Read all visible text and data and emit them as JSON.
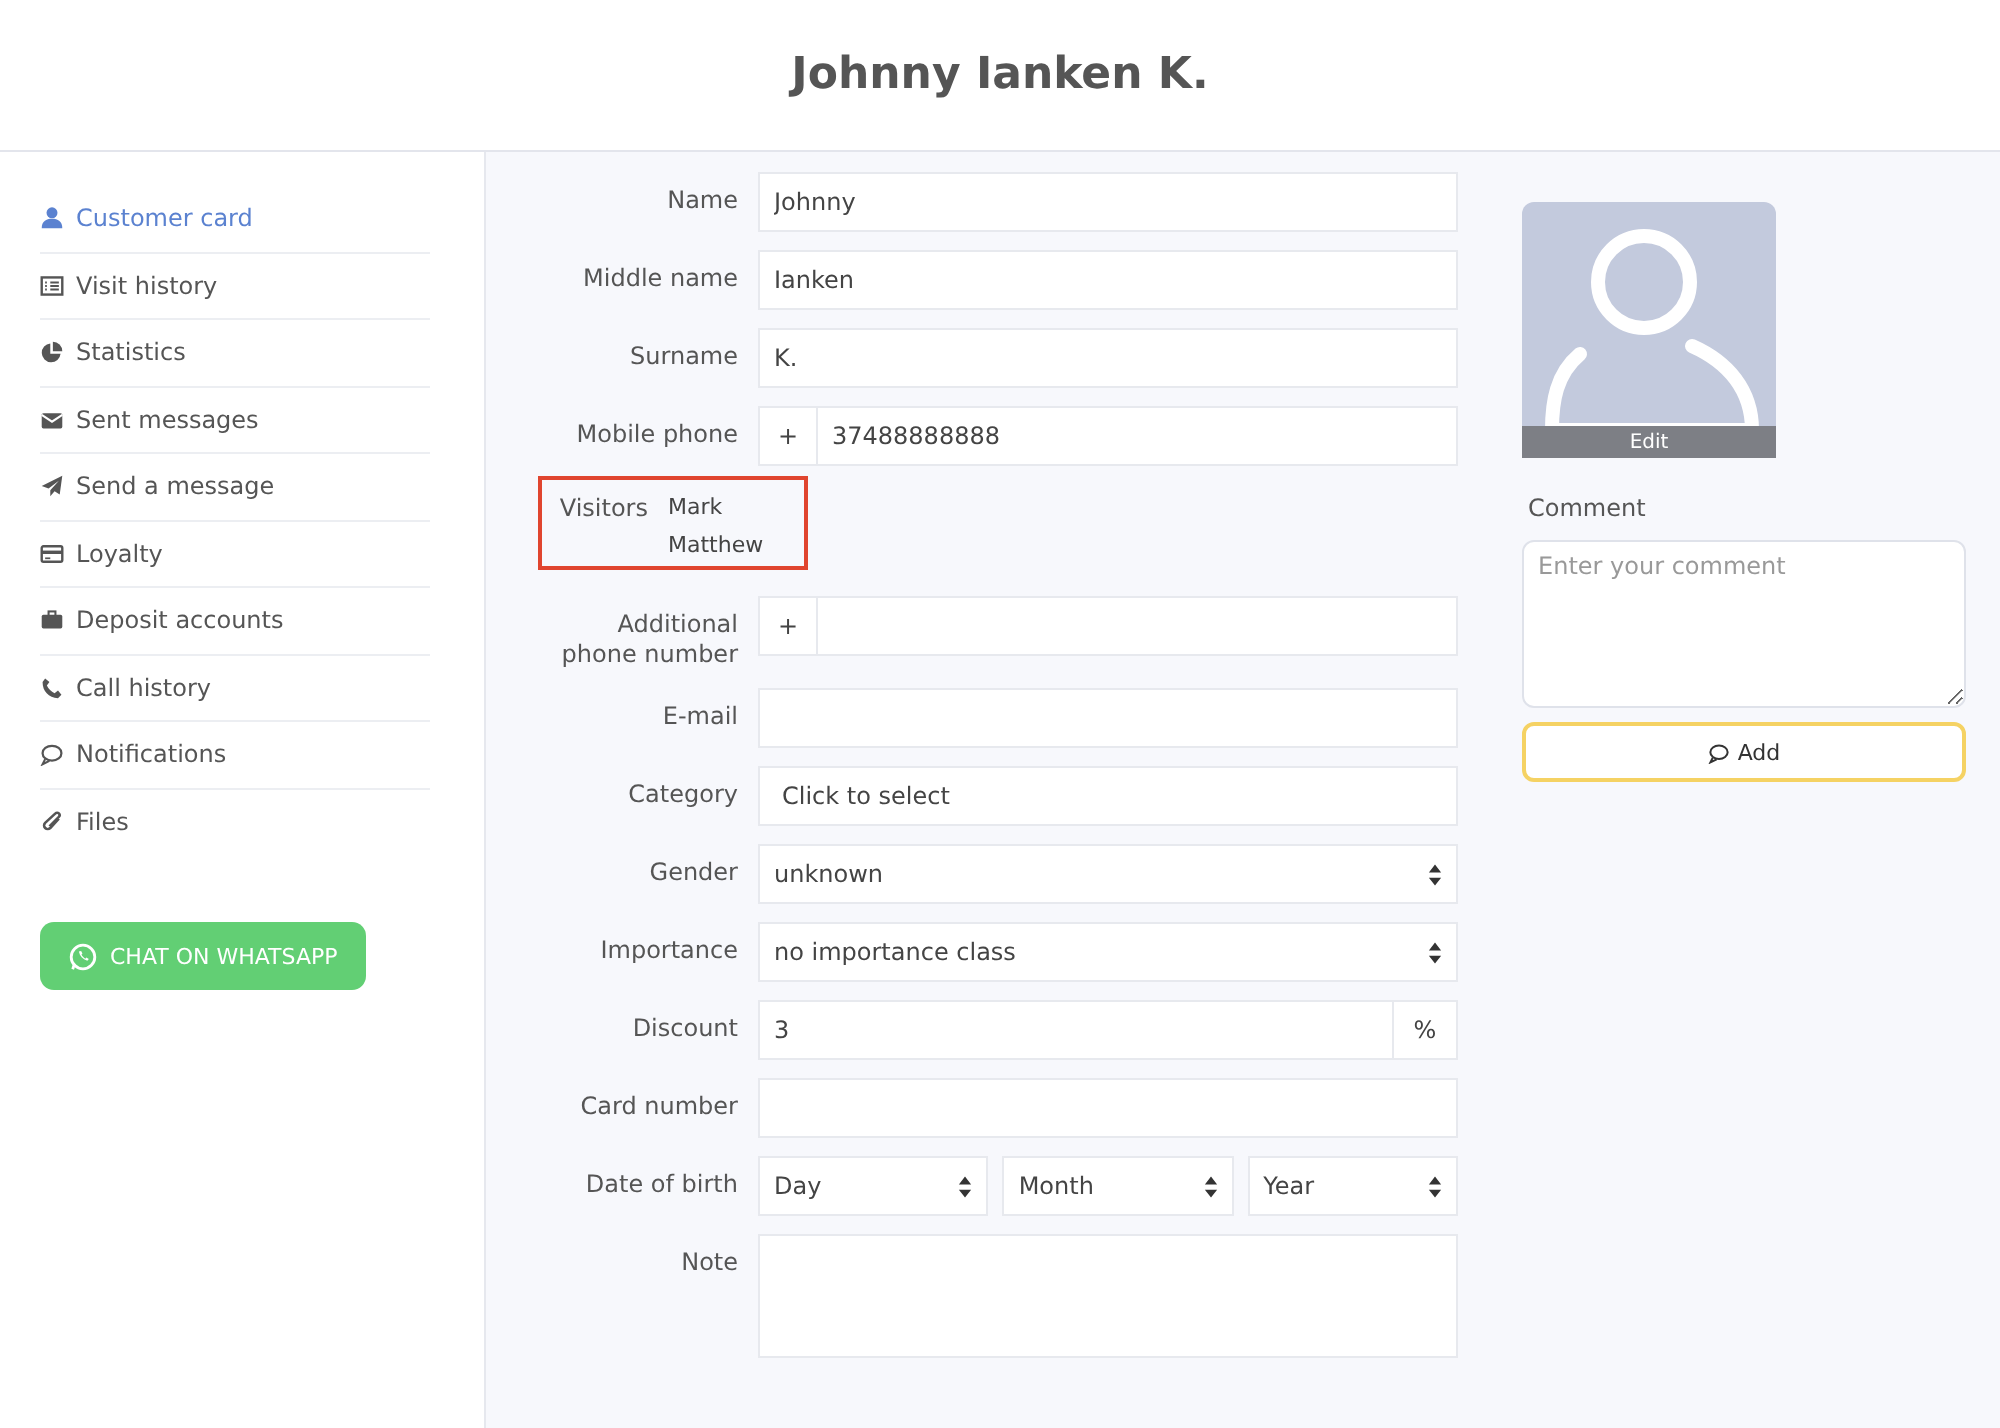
{
  "header": {
    "title": "Johnny Ianken K."
  },
  "sidebar": {
    "items": [
      {
        "label": "Customer card",
        "selected": true
      },
      {
        "label": "Visit history",
        "selected": false
      },
      {
        "label": "Statistics",
        "selected": false
      },
      {
        "label": "Sent messages",
        "selected": false
      },
      {
        "label": "Send a message",
        "selected": false
      },
      {
        "label": "Loyalty",
        "selected": false
      },
      {
        "label": "Deposit accounts",
        "selected": false
      },
      {
        "label": "Call history",
        "selected": false
      },
      {
        "label": "Notifications",
        "selected": false
      },
      {
        "label": "Files",
        "selected": false
      }
    ],
    "whatsapp_button": "CHAT ON WHATSAPP"
  },
  "form": {
    "fields": [
      {
        "kind": "text",
        "label": "Name",
        "value": "Johnny"
      },
      {
        "kind": "text",
        "label": "Middle name",
        "value": "Ianken"
      },
      {
        "kind": "text",
        "label": "Surname",
        "value": "K."
      },
      {
        "kind": "phone",
        "label": "Mobile phone",
        "prefix": "+",
        "value": "37488888888"
      },
      {
        "kind": "visitors",
        "label": "Visitors",
        "names": [
          "Mark",
          "Matthew"
        ],
        "highlighted": true
      },
      {
        "kind": "phone",
        "label": "Additional phone number",
        "prefix": "+"
      },
      {
        "kind": "text",
        "label": "E-mail"
      },
      {
        "kind": "picker",
        "label": "Category",
        "value": "Click to select"
      },
      {
        "kind": "select",
        "label": "Gender",
        "value": "unknown"
      },
      {
        "kind": "select",
        "label": "Importance",
        "value": "no importance class"
      },
      {
        "kind": "suffix",
        "label": "Discount",
        "value": "3",
        "suffix": "%"
      },
      {
        "kind": "text",
        "label": "Card number"
      },
      {
        "kind": "date",
        "label": "Date of birth",
        "parts": [
          "Day",
          "Month",
          "Year"
        ]
      },
      {
        "kind": "textarea",
        "label": "Note"
      }
    ]
  },
  "profile": {
    "photo_button": "Edit",
    "comment_label": "Comment",
    "comment_placeholder": "Enter your comment",
    "add_button": "Add"
  }
}
